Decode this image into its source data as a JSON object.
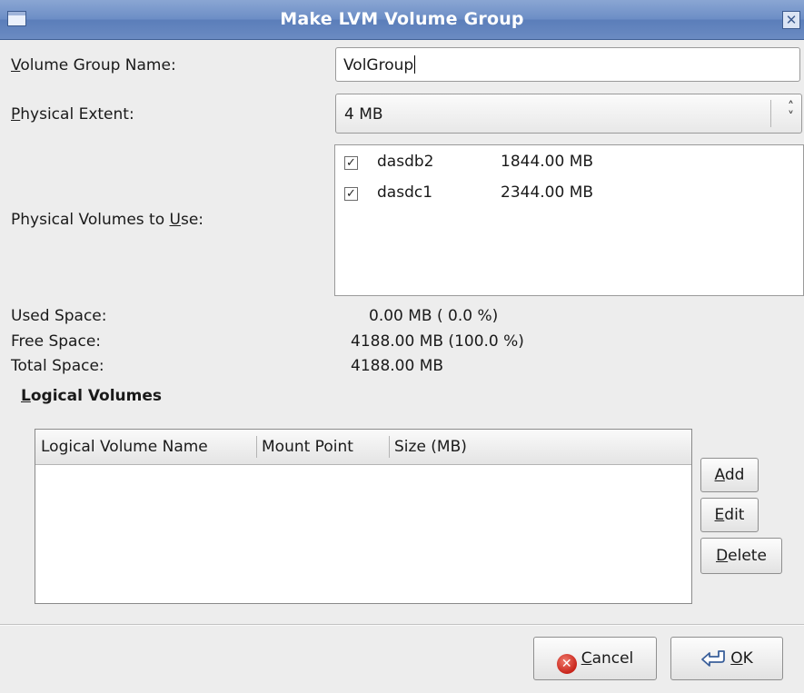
{
  "window": {
    "title": "Make LVM Volume Group",
    "close_glyph": "✕"
  },
  "form": {
    "vg_name_label_ul": "V",
    "vg_name_label_rest": "olume Group Name:",
    "vg_name_value": "VolGroup",
    "pe_label_ul": "P",
    "pe_label_rest": "hysical Extent:",
    "pe_value": "4 MB",
    "pv_label_pre": "Physical Volumes to ",
    "pv_label_ul": "U",
    "pv_label_post": "se:"
  },
  "physical_volumes": [
    {
      "name": "dasdb2",
      "size": "1844.00 MB",
      "checked": true
    },
    {
      "name": "dasdc1",
      "size": "2344.00 MB",
      "checked": true
    }
  ],
  "space": {
    "used_label": "Used Space:",
    "used_value": "0.00 MB  ( 0.0 %)",
    "free_label": "Free Space:",
    "free_value": "4188.00 MB  (100.0 %)",
    "total_label": "Total Space:",
    "total_value": "4188.00 MB"
  },
  "logical_volumes": {
    "section_ul": "L",
    "section_rest": "ogical Volumes",
    "columns": [
      "Logical Volume Name",
      "Mount Point",
      "Size (MB)"
    ],
    "rows": []
  },
  "lv_buttons": {
    "add_ul": "A",
    "add_rest": "dd",
    "edit_ul": "E",
    "edit_rest": "dit",
    "delete_ul": "D",
    "delete_rest": "elete"
  },
  "dialog_buttons": {
    "cancel_ul": "C",
    "cancel_rest": "ancel",
    "ok_ul": "O",
    "ok_rest": "K"
  },
  "icons": {
    "cancel": "cancel-icon",
    "ok": "ok-icon",
    "window": "window-menu-icon",
    "close": "close-icon"
  },
  "colors": {
    "titlebar": "#6d8ec6",
    "cancel_icon": "#c8241a"
  }
}
